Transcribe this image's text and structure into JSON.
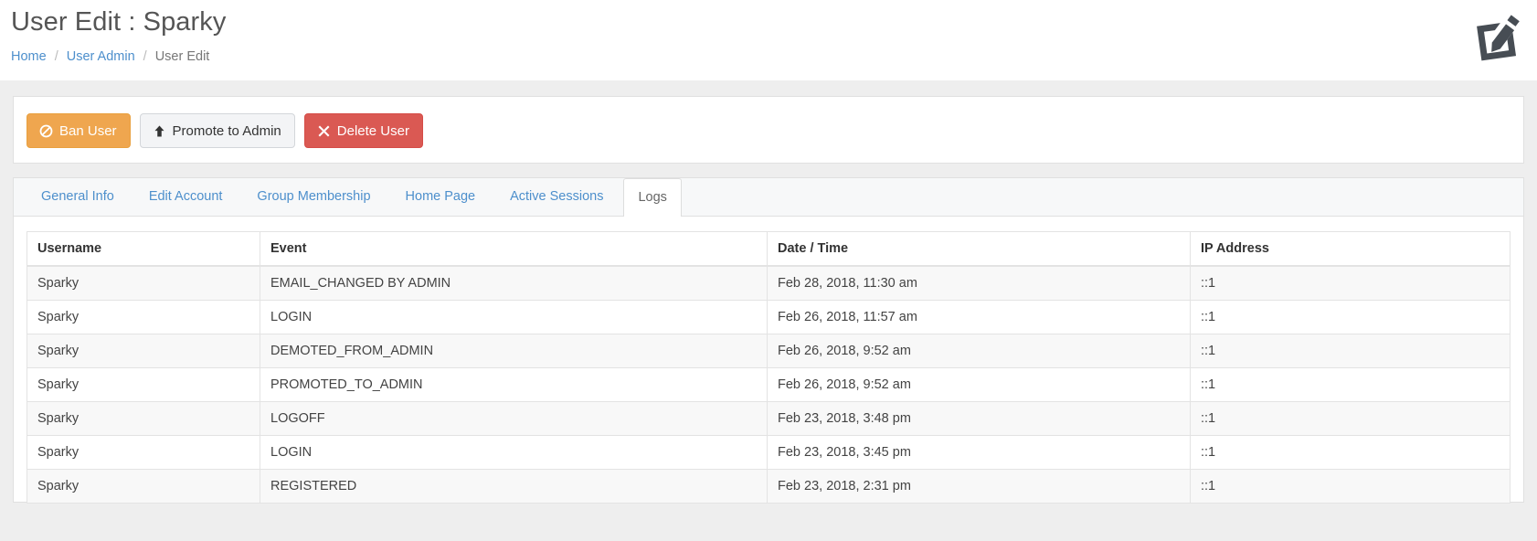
{
  "header": {
    "title": "User Edit : Sparky",
    "icon": "edit-pencil-square-icon",
    "breadcrumb": [
      {
        "label": "Home",
        "current": false
      },
      {
        "label": "User Admin",
        "current": false
      },
      {
        "label": "User Edit",
        "current": true
      }
    ],
    "separator": "/"
  },
  "actions": {
    "ban": {
      "label": "Ban User",
      "icon": "ban-icon",
      "color": "#efa64f"
    },
    "promote": {
      "label": "Promote to Admin",
      "icon": "arrow-up-icon",
      "color": "#f3f4f6"
    },
    "delete": {
      "label": "Delete User",
      "icon": "close-x-icon",
      "color": "#da5953"
    }
  },
  "tabs": [
    {
      "label": "General Info",
      "active": false
    },
    {
      "label": "Edit Account",
      "active": false
    },
    {
      "label": "Group Membership",
      "active": false
    },
    {
      "label": "Home Page",
      "active": false
    },
    {
      "label": "Active Sessions",
      "active": false
    },
    {
      "label": "Logs",
      "active": true
    }
  ],
  "log_table": {
    "columns": [
      "Username",
      "Event",
      "Date / Time",
      "IP Address"
    ],
    "rows": [
      [
        "Sparky",
        "EMAIL_CHANGED BY ADMIN",
        "Feb 28, 2018, 11:30 am",
        "::1"
      ],
      [
        "Sparky",
        "LOGIN",
        "Feb 26, 2018, 11:57 am",
        "::1"
      ],
      [
        "Sparky",
        "DEMOTED_FROM_ADMIN",
        "Feb 26, 2018, 9:52 am",
        "::1"
      ],
      [
        "Sparky",
        "PROMOTED_TO_ADMIN",
        "Feb 26, 2018, 9:52 am",
        "::1"
      ],
      [
        "Sparky",
        "LOGOFF",
        "Feb 23, 2018, 3:48 pm",
        "::1"
      ],
      [
        "Sparky",
        "LOGIN",
        "Feb 23, 2018, 3:45 pm",
        "::1"
      ],
      [
        "Sparky",
        "REGISTERED",
        "Feb 23, 2018, 2:31 pm",
        "::1"
      ]
    ]
  },
  "colors": {
    "link": "#4d8fcc",
    "warning": "#efa64f",
    "danger": "#da5953",
    "page_background": "#eeeeee"
  }
}
